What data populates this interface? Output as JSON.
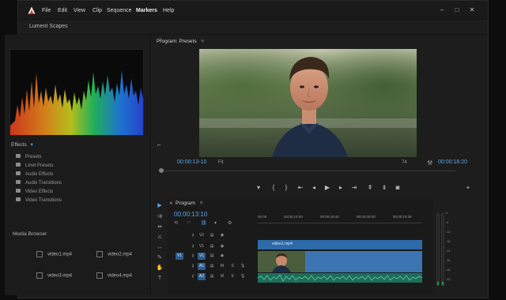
{
  "menubar": {
    "items": [
      "File",
      "Edit",
      "View",
      "Clip",
      "Sequence",
      "Markers",
      "Help"
    ],
    "window_controls": {
      "minimize": "–",
      "maximize": "□",
      "close": "✕"
    }
  },
  "workspace": {
    "title": "Lument Scapes"
  },
  "effects": {
    "header": "Effects",
    "items": [
      "Presets",
      "Lmet Presets",
      "Audio Effects",
      "Audio Transitions",
      "Video Effects",
      "Video Transitions"
    ]
  },
  "media_browser": {
    "header": "Media Browser",
    "items": [
      "video1.mp4",
      "video2.mp4",
      "video3.mp4",
      "video4.mp4"
    ]
  },
  "program_monitor": {
    "title": "Program: Presets",
    "timecode_left": "00:00:13-10",
    "fit_label": "Fit",
    "zoom_label": "74",
    "timecode_right": "00:00:18:20"
  },
  "timeline": {
    "title": "Program",
    "timecode": "00:00:13:10",
    "ruler_labels": [
      "00:00",
      "00:00:14:00",
      "00:00:18:40",
      "00:00:09:30",
      "00:00:15:35"
    ],
    "clip_label": "video1.mp4",
    "tracks": {
      "v2": "V2",
      "v1": "V1",
      "a1": "A1",
      "a2": "A2"
    }
  },
  "colors": {
    "accent": "#5aa6e6",
    "clip_video": "#3d74b2",
    "clip_audio": "#1d6e59",
    "panel_bg": "#1d1d1d"
  },
  "icons": {
    "toolbar": [
      "selection-tool-icon",
      "track-select-icon",
      "ripple-edit-icon",
      "razor-icon",
      "slip-icon",
      "pen-icon",
      "hand-icon",
      "text-icon"
    ],
    "transport": [
      "marker-icon",
      "in-point-icon",
      "out-point-icon",
      "go-to-in-icon",
      "step-back-icon",
      "play-icon",
      "step-forward-icon",
      "go-to-out-icon",
      "lift-icon",
      "extract-icon",
      "export-frame-icon",
      "add-button-icon"
    ]
  }
}
